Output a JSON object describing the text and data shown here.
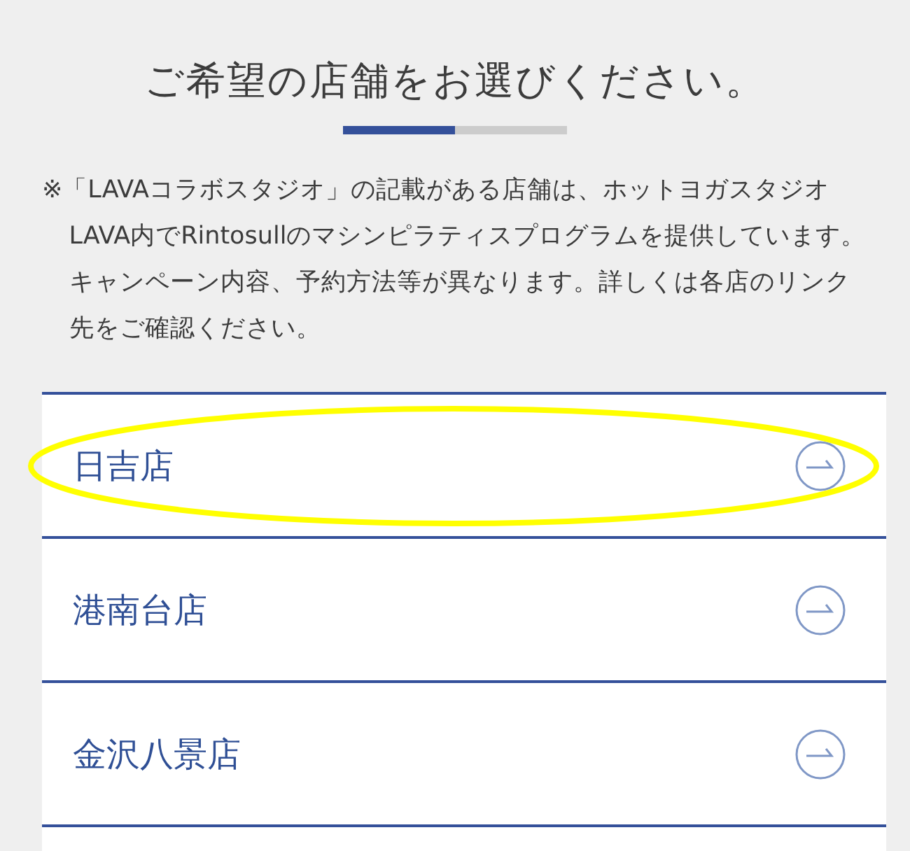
{
  "heading": "ご希望の店舗をお選びください。",
  "progress": {
    "level": 0.5
  },
  "note": "※「LAVAコラボスタジオ」の記載がある店舗は、ホットヨガスタジオLAVA内でRintosullのマシンピラティスプログラムを提供しています。キャンペーン内容、予約方法等が異なります。詳しくは各店のリンク先をご確認ください。",
  "stores": [
    {
      "name": "日吉店",
      "highlighted": true
    },
    {
      "name": "港南台店",
      "highlighted": false
    },
    {
      "name": "金沢八景店",
      "highlighted": false
    }
  ]
}
